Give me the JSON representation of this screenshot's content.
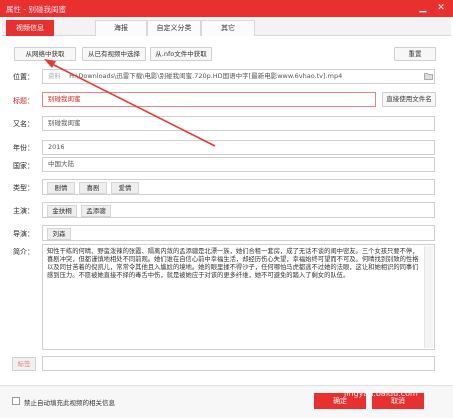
{
  "window": {
    "title": "属性 - 别碰我闺蜜",
    "minimize_glyph": "▁",
    "close_glyph": "✕"
  },
  "tabs": [
    {
      "label": "视频信息"
    },
    {
      "label": "海报"
    },
    {
      "label": "自定义分类"
    },
    {
      "label": "其它"
    }
  ],
  "toolbar": {
    "fetch_net": "从网络中获取",
    "from_existing": "从已有视频中选择",
    "from_nfo": "从.nfo文件中获取",
    "reset": "重置"
  },
  "fields": {
    "location_label": "位置：",
    "location_prefix": "资料",
    "location_value": "H:\\Downloads\\迅雷下载\\电影\\别碰我闺蜜.720p.HD国语中字[最新电影www.6vhao.tv].mp4",
    "title_label": "标题：",
    "title_value": "别碰我闺蜜",
    "use_filename_btn": "直接使用文件名",
    "alt_name_label": "又名：",
    "alt_name_value": "别碰我闺蜜",
    "year_label": "年份：",
    "year_value": "2016",
    "country_label": "国家：",
    "country_value": "中国大陆",
    "genre_label": "类型：",
    "genres": [
      "剧情",
      "喜剧",
      "爱情"
    ],
    "cast_label": "主演：",
    "cast": [
      "金扶桐",
      "孟添骢"
    ],
    "director_label": "导演：",
    "directors": [
      "刘森"
    ],
    "synopsis_label": "简介：",
    "synopsis": "知性干练的何晴、野蛮泼辣的张霞、隔离内敛的孟添骢是北漂一族，她们合租一套房，成了无话不谈的闺中密友。三个女孩只要不停，喜剧冲突，但都谨慎地相处不同前观。她们谁在自信心前中幸福生活，却经历伤心失望，幸福始终可望而不可及。何晴找到别致的性格以及同甘苦着的倪凯儿，常常令其他且入尴尬的境地。她的眼里揉不得沙子，任何哪怕马虎都逃不过她的法眼，这让和她相识的同事们感到压力。不愿被她直接不择的毒舌中伤，就是被她应于对该的更多纤维，她不可避免的踏入了剩女的队伍。",
    "tags_label": "标签"
  },
  "footer": {
    "auto_fetch_label": "禁止自动填充此视频的相关信息",
    "confirm": "确定",
    "cancel": "取消",
    "watermark": "jingyan.baidu.com"
  },
  "colors": {
    "accent": "#e8312f",
    "arrow": "#e83a34"
  }
}
